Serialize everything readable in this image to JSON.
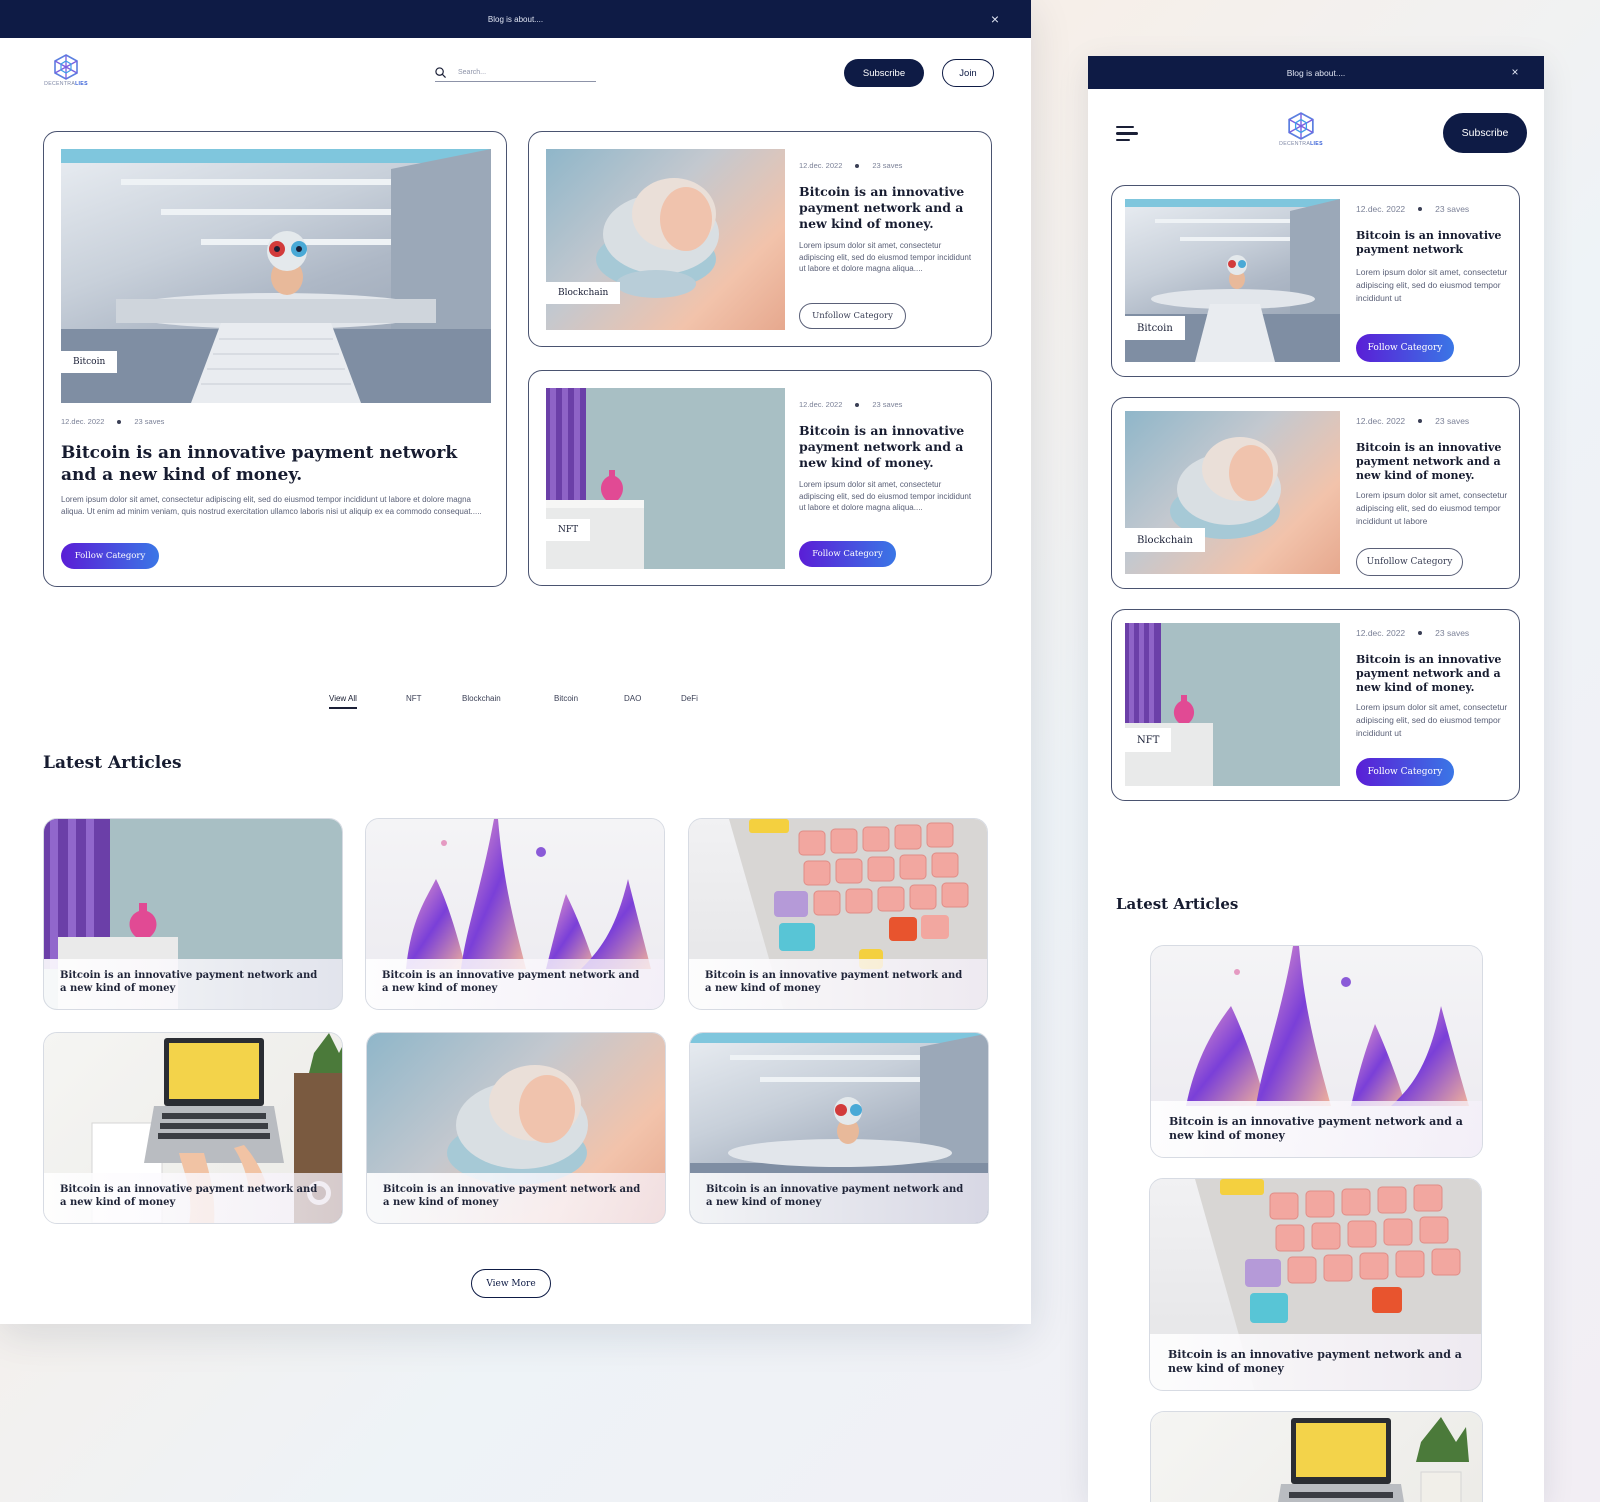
{
  "banner": {
    "text": "Blog is about....",
    "close": "×"
  },
  "brand": {
    "name_a": "DECENTRA",
    "name_b": "LIES"
  },
  "search": {
    "placeholder": "Search..."
  },
  "nav": {
    "subscribe": "Subscribe",
    "join": "Join"
  },
  "featured": [
    {
      "tag": "Bitcoin",
      "date": "12.dec. 2022",
      "saves": "23 saves",
      "title": "Bitcoin is an innovative payment network and a new kind of money.",
      "body": "Lorem ipsum dolor sit amet, consectetur adipiscing elit, sed do eiusmod tempor incididunt ut labore et dolore magna aliqua. Ut enim ad minim veniam, quis nostrud exercitation ullamco laboris nisi ut aliquip ex ea commodo consequat.....",
      "button": "Follow Category"
    },
    {
      "tag": "Blockchain",
      "date": "12.dec. 2022",
      "saves": "23 saves",
      "title": "Bitcoin is an innovative payment network and a new kind of money.",
      "body": "Lorem ipsum dolor sit amet, consectetur adipiscing elit, sed do eiusmod tempor incididunt ut labore et dolore magna aliqua....",
      "button": "Unfollow Category"
    },
    {
      "tag": "NFT",
      "date": "12.dec. 2022",
      "saves": "23 saves",
      "title": "Bitcoin is an innovative payment network and a new kind of money.",
      "body": "Lorem ipsum dolor sit amet, consectetur adipiscing elit, sed do eiusmod tempor incididunt ut labore et dolore magna aliqua....",
      "button": "Follow Category"
    }
  ],
  "tabs": [
    "View All",
    "NFT",
    "Blockchain",
    "Bitcoin",
    "DAO",
    "DeFi"
  ],
  "latest": {
    "heading": "Latest Articles",
    "caption": "Bitcoin is an innovative payment network and a new kind of money",
    "view_more": "View More"
  },
  "mobile": {
    "banner": "Blog is about....",
    "subscribe": "Subscribe",
    "cards": [
      {
        "tag": "Bitcoin",
        "date": "12.dec. 2022",
        "saves": "23 saves",
        "title": "Bitcoin is an innovative payment network",
        "body": "Lorem ipsum dolor sit amet, consectetur adipiscing elit, sed do eiusmod tempor incididunt ut",
        "button": "Follow Category"
      },
      {
        "tag": "Blockchain",
        "date": "12.dec. 2022",
        "saves": "23 saves",
        "title": "Bitcoin is an innovative payment network and a new kind of money.",
        "body": "Lorem ipsum dolor sit amet, consectetur adipiscing elit, sed do eiusmod tempor incididunt ut labore",
        "button": "Unfollow Category"
      },
      {
        "tag": "NFT",
        "date": "12.dec. 2022",
        "saves": "23 saves",
        "title": "Bitcoin is an innovative payment network and a new kind of money.",
        "body": "Lorem ipsum dolor sit amet, consectetur adipiscing elit, sed do eiusmod tempor incididunt ut",
        "button": "Follow Category"
      }
    ],
    "latest_heading": "Latest Articles"
  },
  "colors": {
    "navy": "#0e1b45",
    "accent_start": "#5a1ed6",
    "accent_end": "#3a76e6"
  }
}
